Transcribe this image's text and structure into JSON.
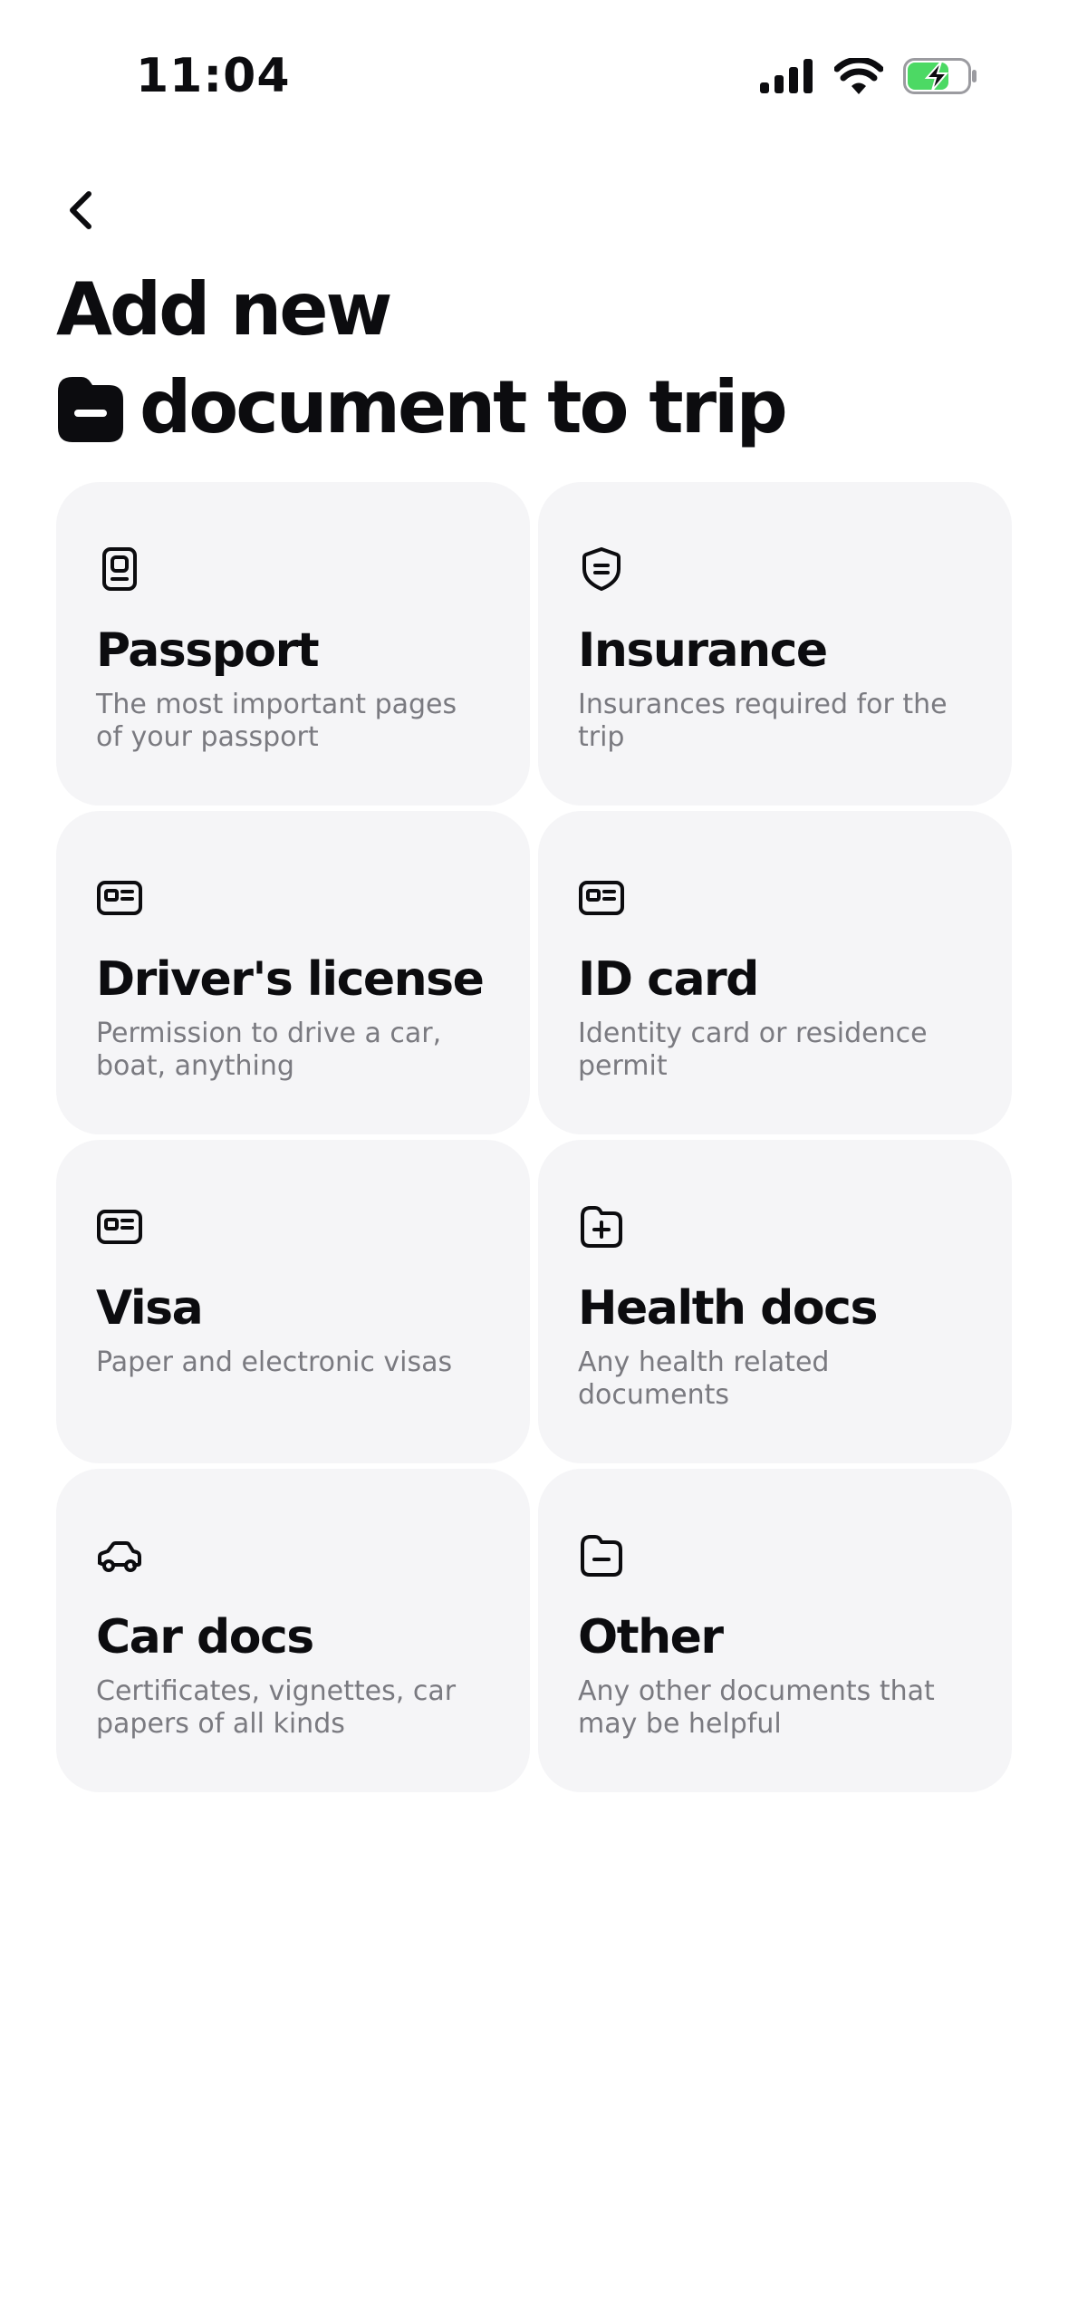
{
  "status_bar": {
    "time": "11:04"
  },
  "header": {
    "title_line1": "Add new",
    "title_line2": "document to trip"
  },
  "cards": [
    {
      "title": "Passport",
      "description": "The most important pages of your passport",
      "icon": "passport-icon"
    },
    {
      "title": "Insurance",
      "description": "Insurances required for the trip",
      "icon": "shield-icon"
    },
    {
      "title": "Driver's license",
      "description": "Permission to drive a car, boat, anything",
      "icon": "id-card-icon"
    },
    {
      "title": "ID card",
      "description": "Identity card or residence permit",
      "icon": "id-card-icon"
    },
    {
      "title": "Visa",
      "description": "Paper and electronic visas",
      "icon": "id-card-icon"
    },
    {
      "title": "Health docs",
      "description": "Any health related documents",
      "icon": "folder-plus-icon"
    },
    {
      "title": "Car docs",
      "description": "Certificates, vignettes, car papers of all kinds",
      "icon": "car-icon"
    },
    {
      "title": "Other",
      "description": "Any other documents that may be helpful",
      "icon": "folder-minus-icon"
    }
  ],
  "colors": {
    "card_background": "#f5f5f7",
    "text_primary": "#0c0c0f",
    "text_secondary": "#7a7a80",
    "battery_accent": "#4cd964"
  }
}
